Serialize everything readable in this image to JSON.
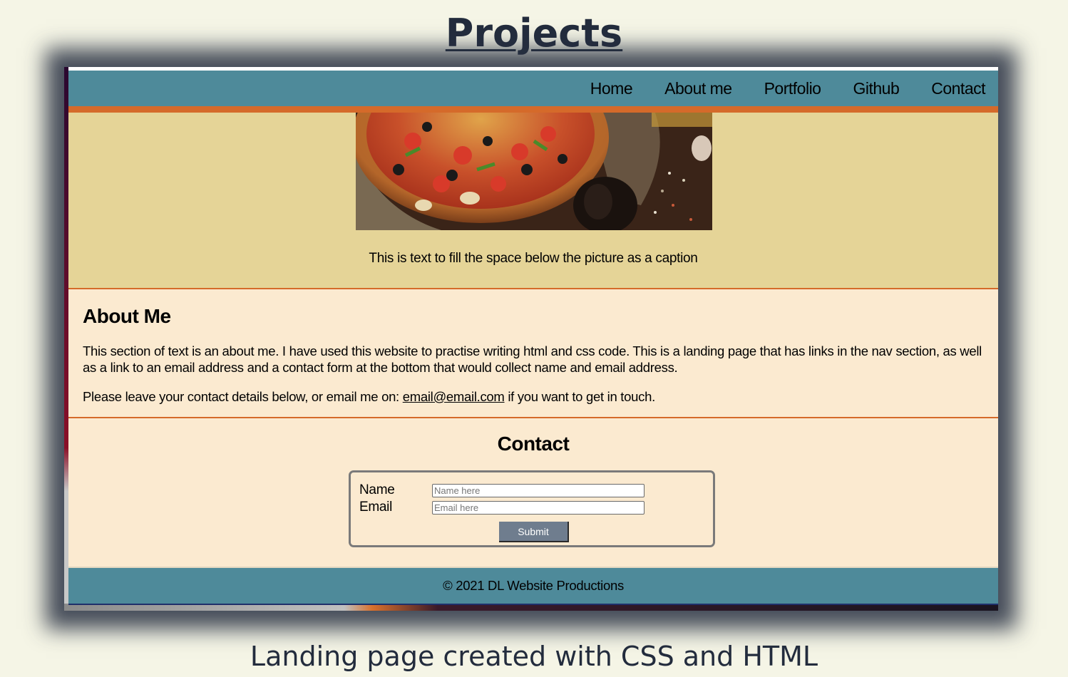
{
  "page": {
    "heading": "Projects",
    "caption": "Landing page created with CSS and HTML"
  },
  "site": {
    "nav": {
      "items": [
        {
          "label": "Home"
        },
        {
          "label": "About me"
        },
        {
          "label": "Portfolio"
        },
        {
          "label": "Github"
        },
        {
          "label": "Contact"
        }
      ]
    },
    "hero": {
      "image_icon": "pizza-image",
      "caption": "This is text to fill the space below the picture as a caption"
    },
    "about": {
      "title": "About Me",
      "text": "This section of text is an about me. I have used this website to practise writing html and css code. This is a landing page that has links in the nav section, as well as a link to an email address and a contact form at the bottom that would collect name and email address.",
      "contact_prefix": "Please leave your contact details below, or email me on: ",
      "email_link": "email@email.com",
      "contact_suffix": " if you want to get in touch."
    },
    "contact": {
      "title": "Contact",
      "name_label": "Name",
      "name_placeholder": "Name here",
      "name_value": "",
      "email_label": "Email",
      "email_placeholder": "Email here",
      "email_value": "",
      "submit_label": "Submit"
    },
    "footer": {
      "text": "© 2021 DL Website Productions"
    }
  },
  "colors": {
    "page_background": "#f5f5e6",
    "heading_text": "#232c3d",
    "nav_background": "#4e8a9a",
    "accent_orange": "#d56a2a",
    "hero_background": "#e5d497",
    "content_background": "#fbead0",
    "submit_button": "#6f7d8e"
  }
}
